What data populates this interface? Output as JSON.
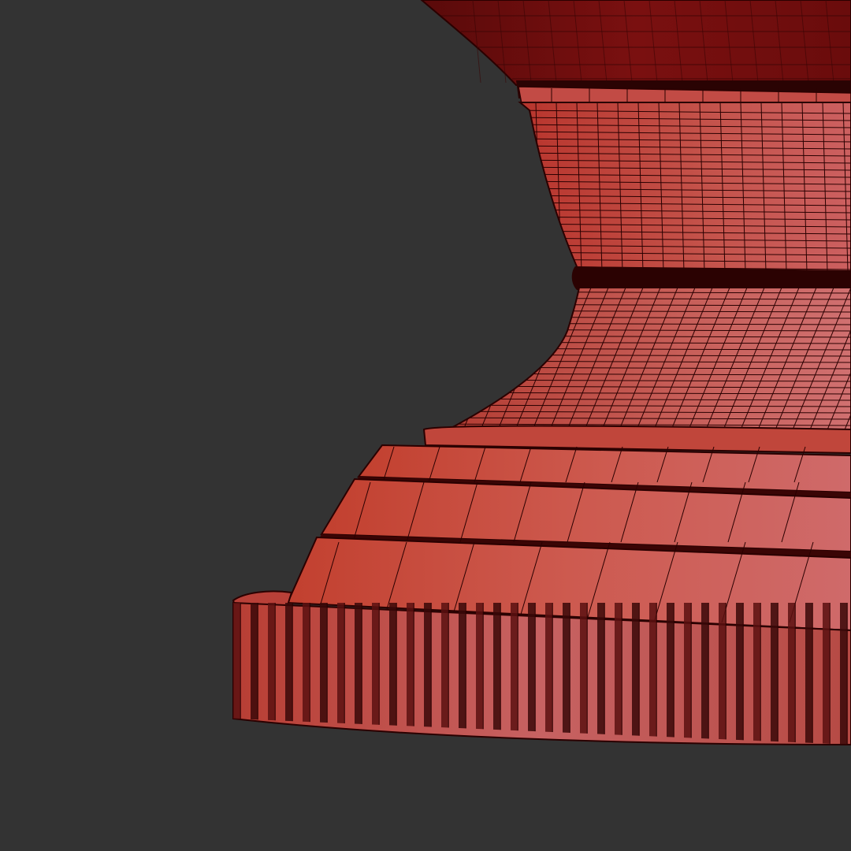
{
  "viewport": {
    "background_color": "#333333"
  },
  "model": {
    "icon": "vase-pedestal-wireframe-icon",
    "colors": {
      "shade_dark": "#3a0606",
      "shade_mid": "#b8352d",
      "shade_light": "#c96a6a",
      "highlight": "#d98c8c",
      "wire": "#2a0000"
    }
  }
}
